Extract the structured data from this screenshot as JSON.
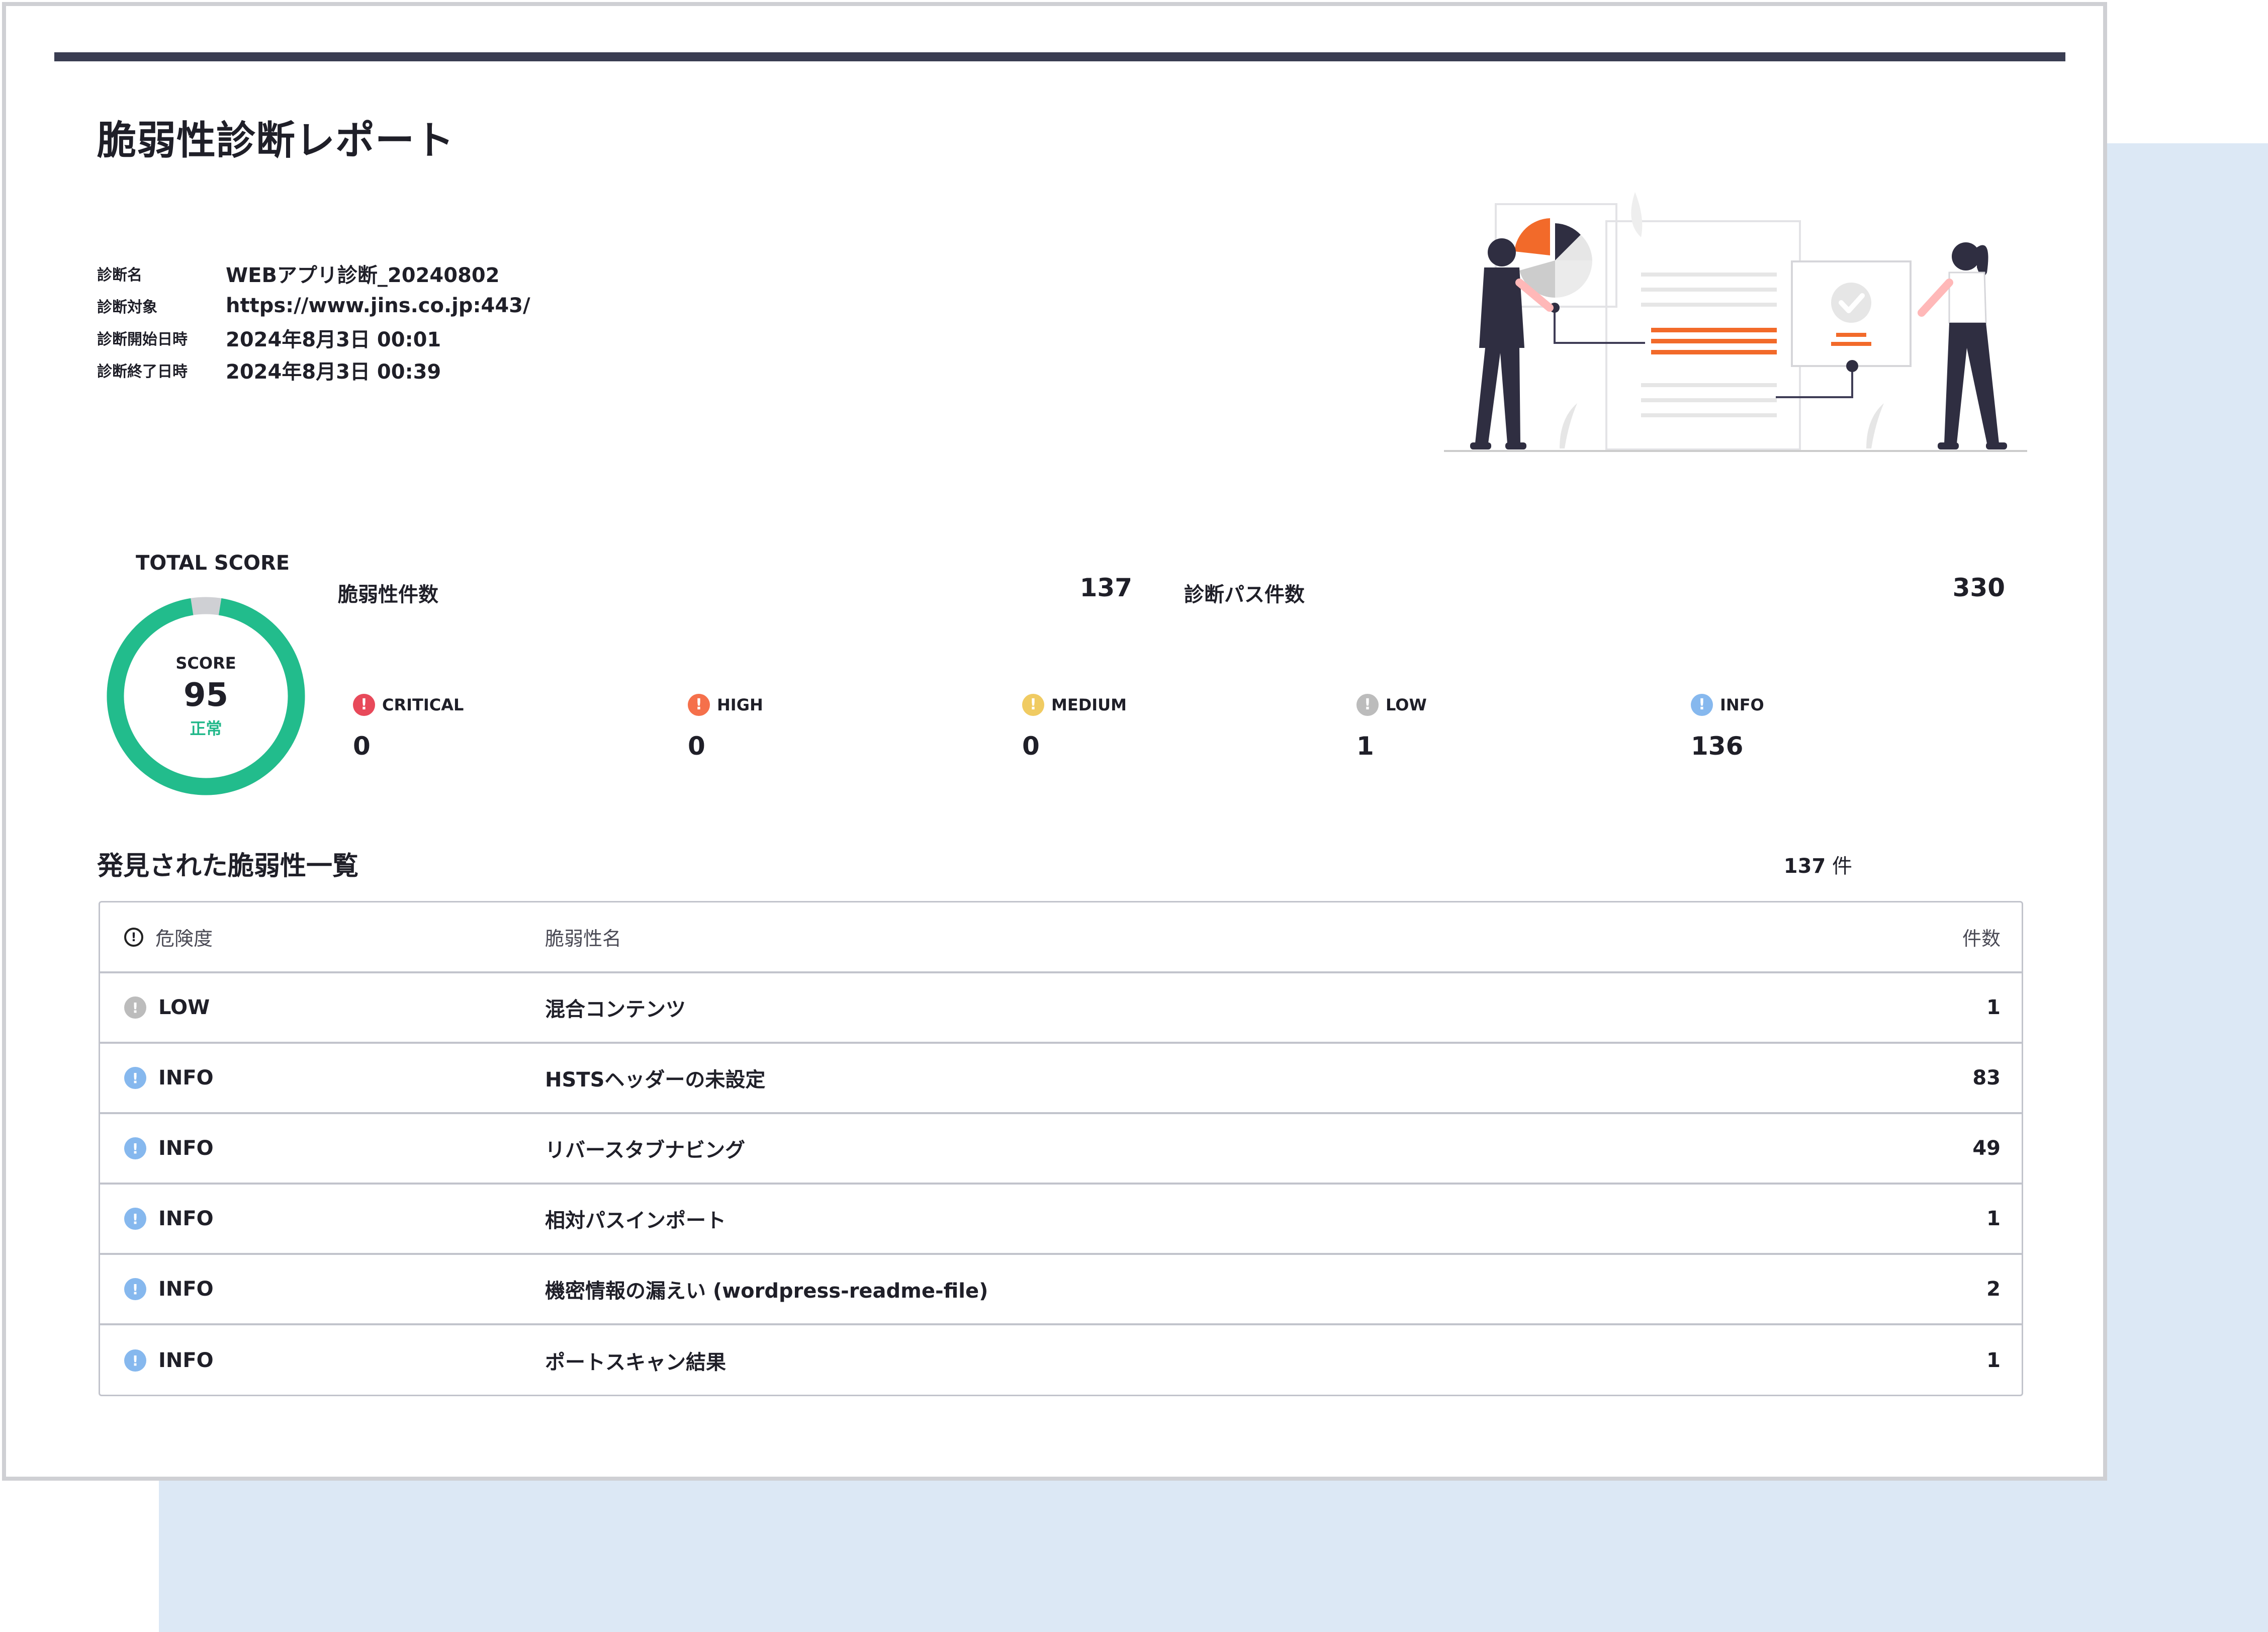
{
  "report": {
    "title": "脆弱性診断レポート",
    "meta": [
      {
        "label": "診断名",
        "value": "WEBアプリ診断_20240802"
      },
      {
        "label": "診断対象",
        "value": "https://www.jins.co.jp:443/"
      },
      {
        "label": "診断開始日時",
        "value": "2024年8月3日 00:01"
      },
      {
        "label": "診断終了日時",
        "value": "2024年8月3日 00:39"
      }
    ]
  },
  "score": {
    "total_label": "TOTAL SCORE",
    "sub_label": "SCORE",
    "value": "95",
    "status": "正常",
    "fraction": 0.95,
    "ring_color": "#22bc8c",
    "track_color": "#cfd0d4"
  },
  "stats": {
    "vuln_label": "脆弱性件数",
    "vuln_value": "137",
    "path_label": "診断パス件数",
    "path_value": "330"
  },
  "severity": [
    {
      "name": "CRITICAL",
      "count": "0",
      "color": "#e8495a",
      "icon": "exclamation-icon"
    },
    {
      "name": "HIGH",
      "count": "0",
      "color": "#f5704b",
      "icon": "exclamation-icon"
    },
    {
      "name": "MEDIUM",
      "count": "0",
      "color": "#f0cb62",
      "icon": "exclamation-icon"
    },
    {
      "name": "LOW",
      "count": "1",
      "color": "#bcbcbc",
      "icon": "exclamation-icon"
    },
    {
      "name": "INFO",
      "count": "136",
      "color": "#86b8ee",
      "icon": "exclamation-icon"
    }
  ],
  "list": {
    "title": "発見された脆弱性一覧",
    "count": "137",
    "count_unit": "件",
    "columns": {
      "severity": "危険度",
      "name": "脆弱性名",
      "count": "件数"
    },
    "rows": [
      {
        "severity": "LOW",
        "name": "混合コンテンツ",
        "count": "1"
      },
      {
        "severity": "INFO",
        "name": "HSTSヘッダーの未設定",
        "count": "83"
      },
      {
        "severity": "INFO",
        "name": "リバースタブナビング",
        "count": "49"
      },
      {
        "severity": "INFO",
        "name": "相対パスインポート",
        "count": "1"
      },
      {
        "severity": "INFO",
        "name": "機密情報の漏えい (wordpress-readme-file)",
        "count": "2"
      },
      {
        "severity": "INFO",
        "name": "ポートスキャン結果",
        "count": "1"
      }
    ]
  }
}
